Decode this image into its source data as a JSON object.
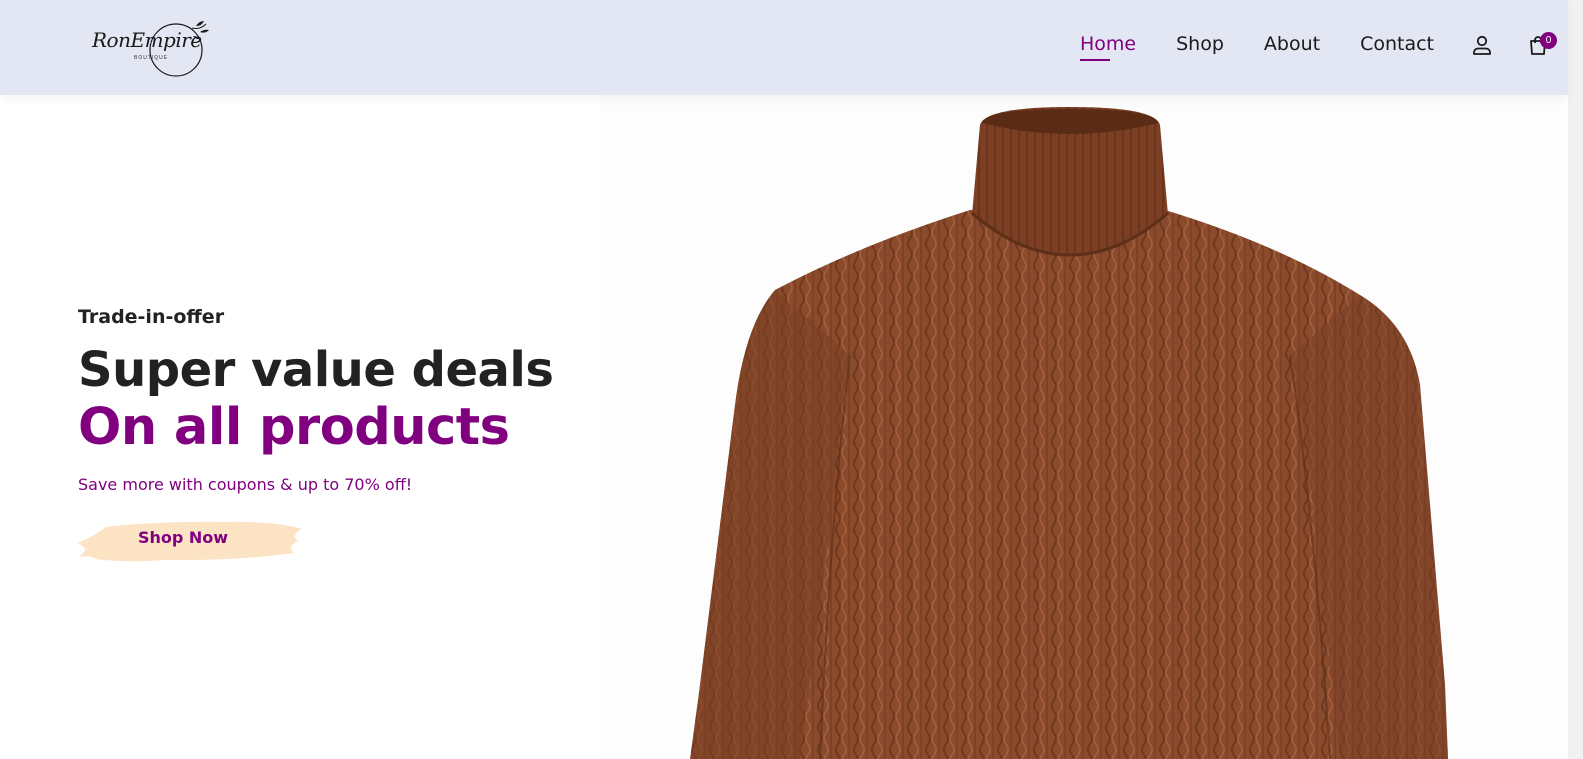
{
  "brand": {
    "logo_text": "RonEmpire",
    "logo_subtext": "BOUTIQUE"
  },
  "nav": {
    "items": [
      {
        "label": "Home",
        "active": true
      },
      {
        "label": "Shop",
        "active": false
      },
      {
        "label": "About",
        "active": false
      },
      {
        "label": "Contact",
        "active": false
      }
    ],
    "cart_count": "0"
  },
  "hero": {
    "eyebrow": "Trade-in-offer",
    "headline": "Super value deals",
    "headline_accent": "On all products",
    "subtext": "Save more with coupons & up to 70% off!",
    "cta_label": "Shop Now"
  },
  "colors": {
    "accent": "#800080",
    "header_bg": "#e3e6f3",
    "cta_bg": "#fbe3c4",
    "sweater": "#8b4a2b"
  },
  "icons": {
    "user": "user-icon",
    "cart": "shopping-bag-icon"
  }
}
